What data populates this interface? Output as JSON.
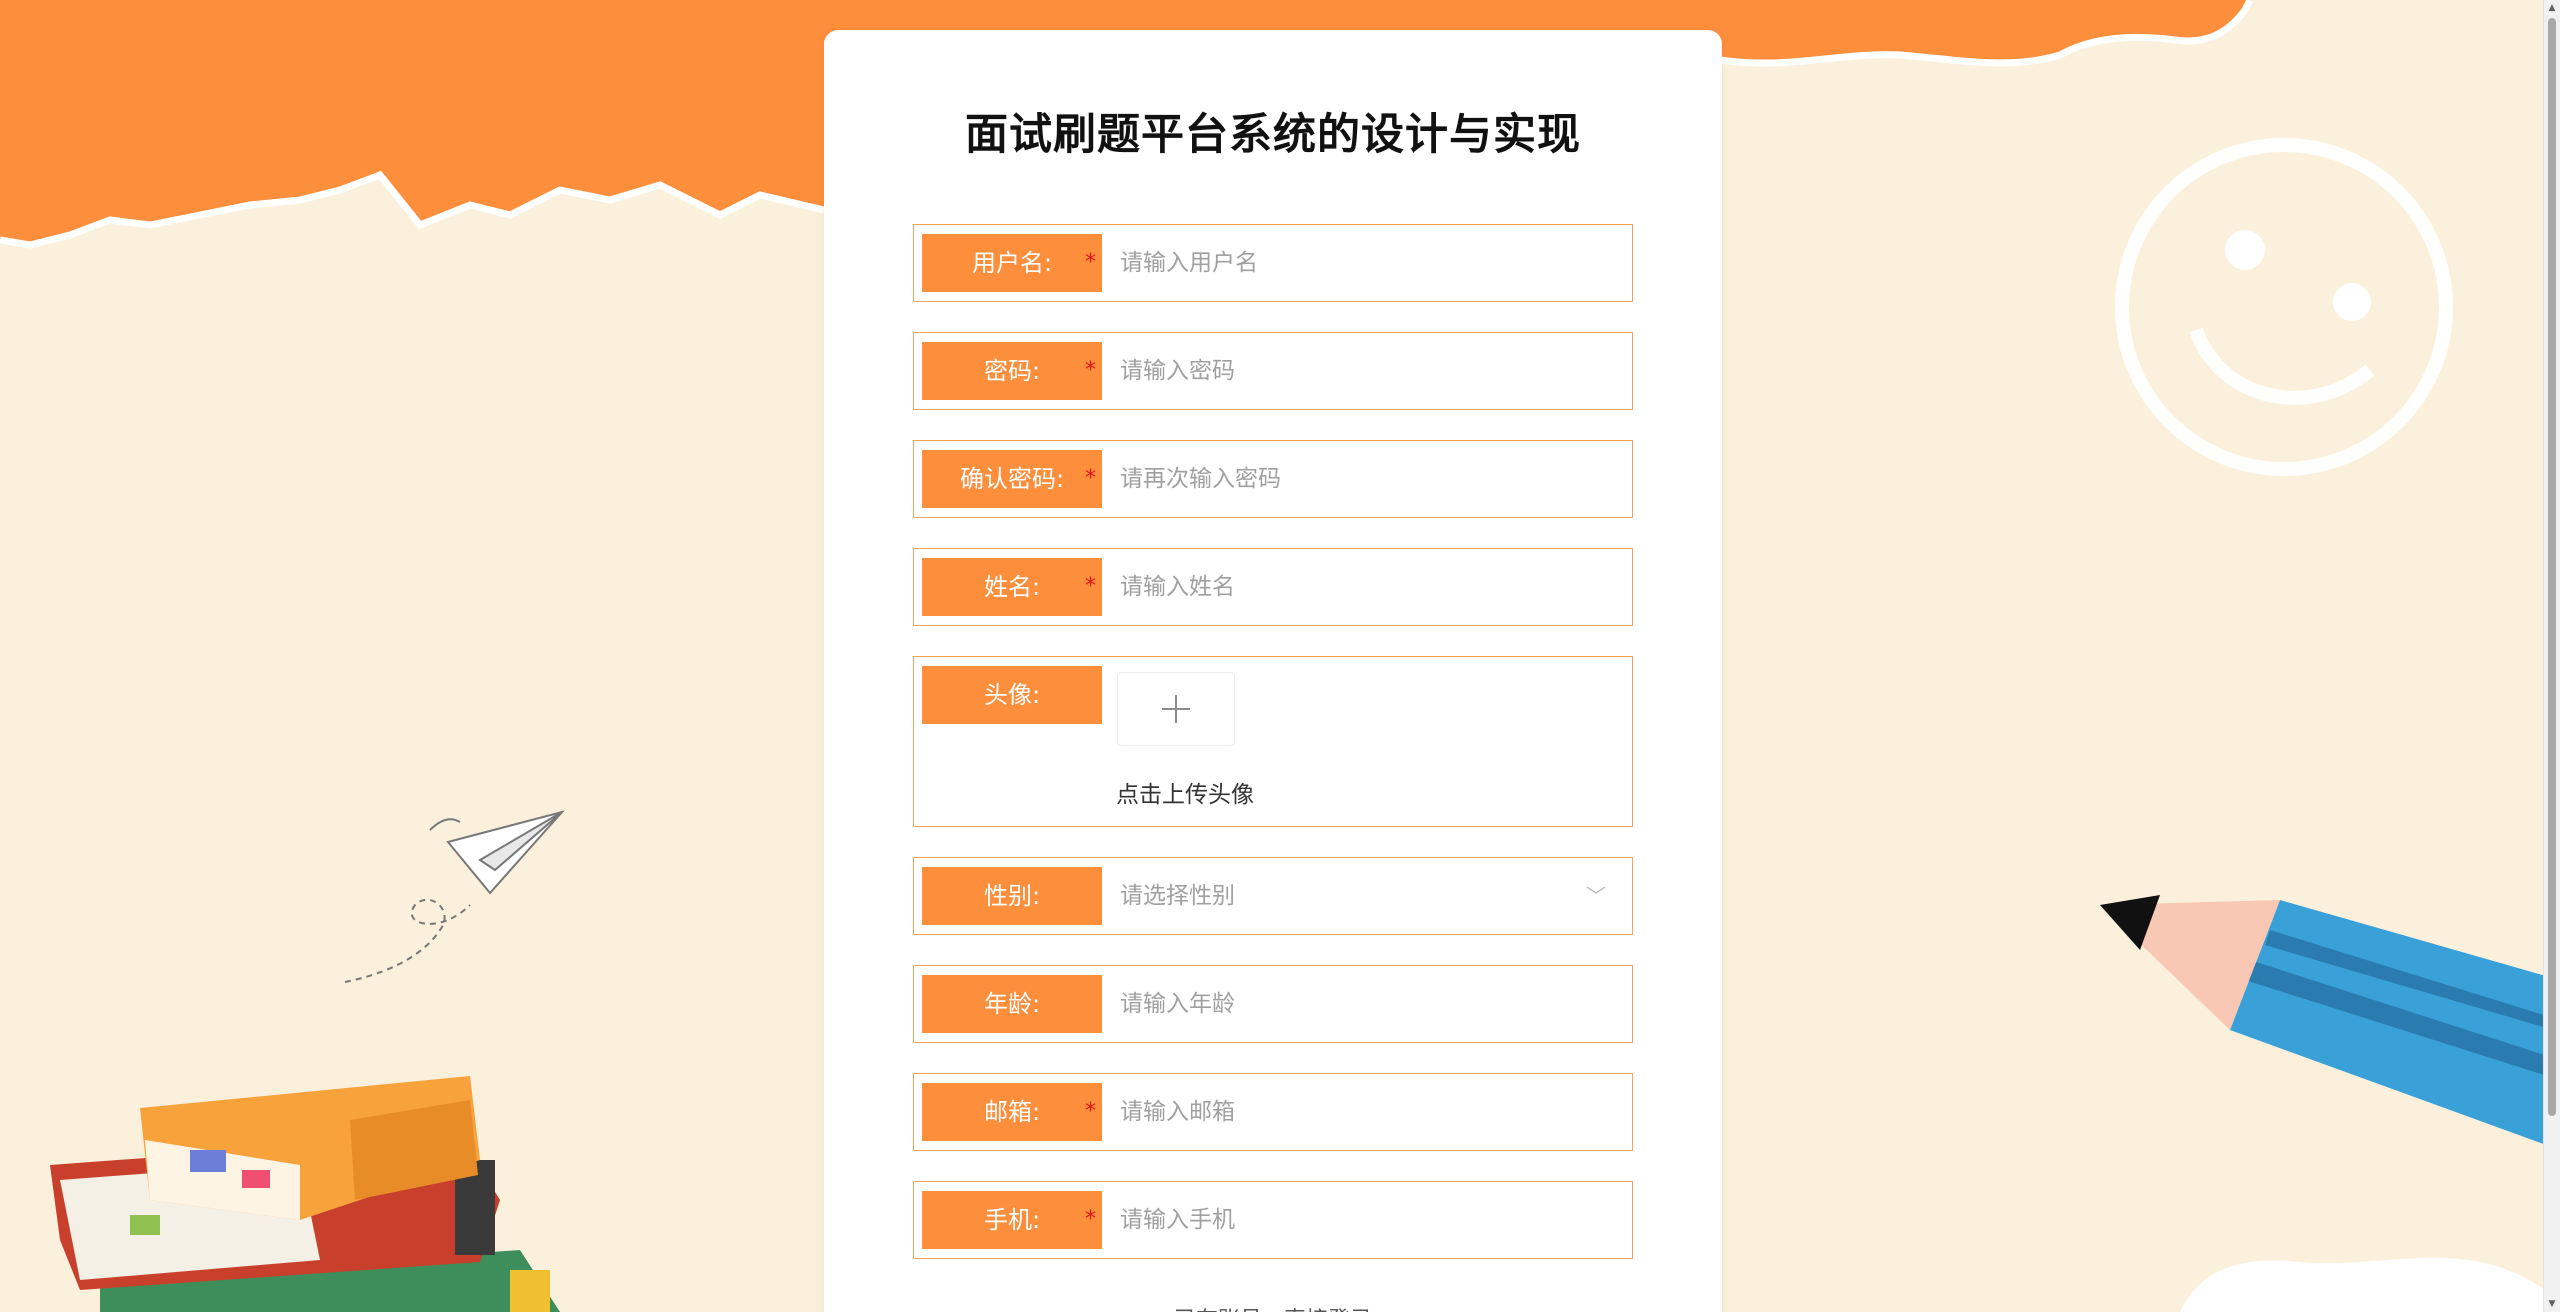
{
  "form": {
    "title": "面试刷题平台系统的设计与实现",
    "fields": [
      {
        "label": "用户名:",
        "required": true,
        "placeholder": "请输入用户名"
      },
      {
        "label": "密码:",
        "required": true,
        "placeholder": "请输入密码"
      },
      {
        "label": "确认密码:",
        "required": true,
        "placeholder": "请再次输入密码"
      },
      {
        "label": "姓名:",
        "required": true,
        "placeholder": "请输入姓名"
      },
      {
        "label": "头像:",
        "required": false,
        "upload_hint": "点击上传头像",
        "upload_icon": "plus-icon"
      },
      {
        "label": "性别:",
        "required": false,
        "placeholder": "请选择性别",
        "icon": "chevron-down-icon"
      },
      {
        "label": "年龄:",
        "required": false,
        "placeholder": "请输入年龄"
      },
      {
        "label": "邮箱:",
        "required": true,
        "placeholder": "请输入邮箱"
      },
      {
        "label": "手机:",
        "required": true,
        "placeholder": "请输入手机"
      }
    ],
    "required_mark": "*",
    "login_link": "已有账号，直接登录"
  },
  "colors": {
    "accent": "#fc8e3c",
    "border": "#f0a45c",
    "background": "#fbf0dc",
    "required": "#e01818"
  }
}
